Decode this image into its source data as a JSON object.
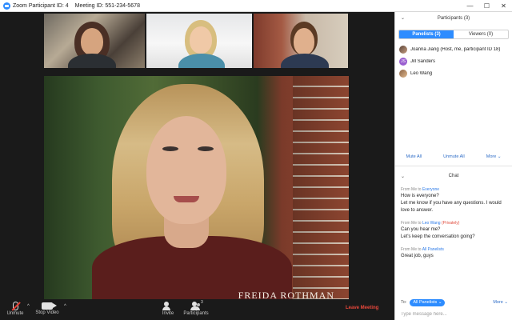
{
  "window": {
    "participant_id": "Zoom Participant ID: 4",
    "meeting_id": "Meeting ID: 551-234-5678",
    "minimize": "—",
    "maximize": "☐",
    "close": "✕"
  },
  "video": {
    "speaker_name": "FREIDA ROTHMAN"
  },
  "toolbar": {
    "unmute_label": "Unmute",
    "stop_video_label": "Stop Video",
    "invite_label": "Invite",
    "participants_label": "Participants",
    "participants_count": "3",
    "leave_label": "Leave Meeting",
    "caret": "^"
  },
  "participants_panel": {
    "title": "Participants (3)",
    "collapse": "⌄",
    "tabs": [
      {
        "label": "Panelists (3)",
        "active": true
      },
      {
        "label": "Viewers (0)",
        "active": false
      }
    ],
    "list": [
      {
        "name": "Joanna Jiang (Host, me, participant ID 18)",
        "initials": ""
      },
      {
        "name": "Jill Sanders",
        "initials": "JS"
      },
      {
        "name": "Leo Wang",
        "initials": ""
      }
    ],
    "mute_all": "Mute All",
    "unmute_all": "Unmute All",
    "more": "More ⌄"
  },
  "chat": {
    "title": "Chat",
    "collapse": "⌄",
    "messages": [
      {
        "from": "From Me to ",
        "to": "Everyone",
        "private": "",
        "text": "How is everyone?\nLet me know if you have any questions. I would love to answer."
      },
      {
        "from": "From Me to ",
        "to": "Leo Wang",
        "private": " (Privately)",
        "text": "Can you hear me?\nLet's keep the conversation going?"
      },
      {
        "from": "From Me to ",
        "to": "All Panelists",
        "private": "",
        "text": "Great job, guys"
      }
    ],
    "to_label": "To:",
    "to_value": "All Panelists ⌄",
    "more": "More ⌄",
    "placeholder": "Type message here..."
  },
  "colors": {
    "accent": "#2d8cff",
    "leave": "#e8473b",
    "link": "#2d7be8",
    "private": "#e04b3c"
  }
}
